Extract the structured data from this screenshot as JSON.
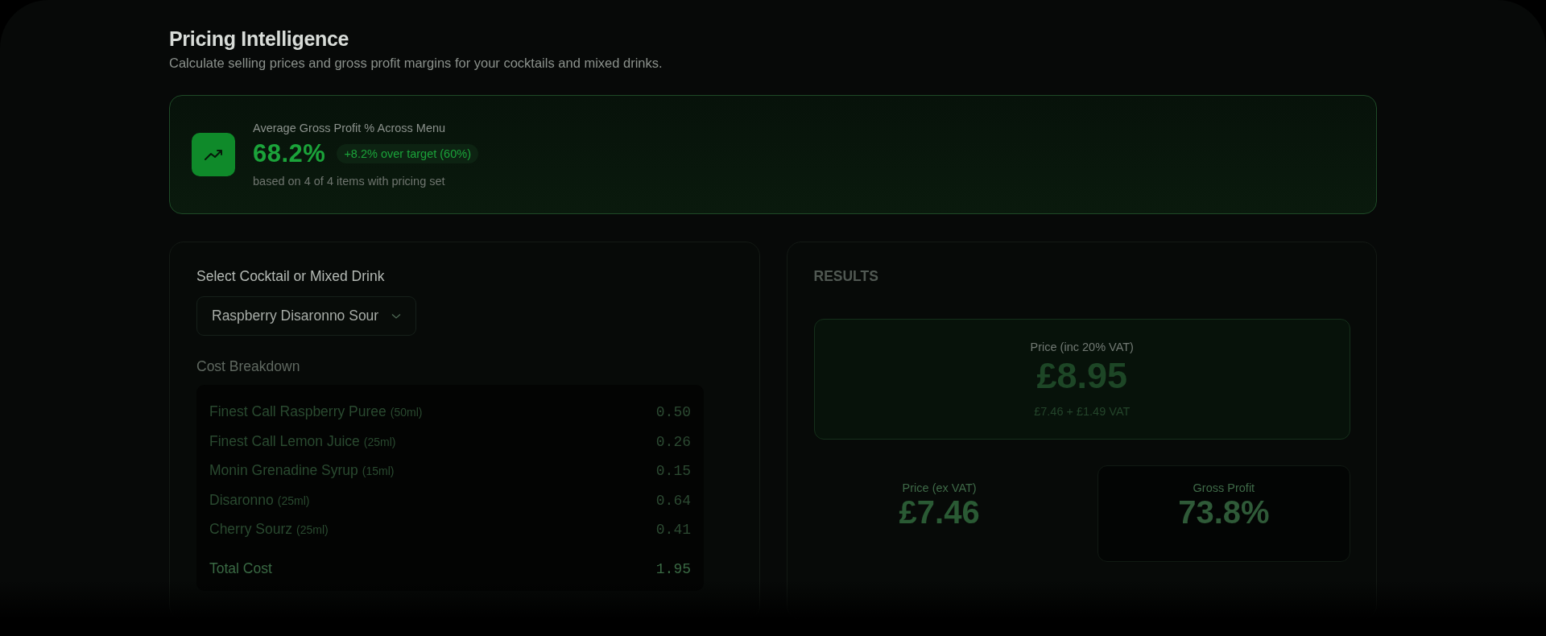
{
  "page": {
    "title": "Pricing Intelligence",
    "subtitle": "Calculate selling prices and gross profit margins for your cocktails and mixed drinks."
  },
  "summary": {
    "label": "Average Gross Profit % Across Menu",
    "value": "68.2%",
    "badge": "+8.2% over target (60%)",
    "note": "based on 4 of 4 items with pricing set"
  },
  "selector": {
    "label": "Select Cocktail or Mixed Drink",
    "value": "Raspberry Disaronno Sour"
  },
  "cost_breakdown": {
    "title": "Cost Breakdown",
    "items": [
      {
        "name": "Finest Call Raspberry Puree",
        "amount": "(50ml)",
        "cost": "0.50"
      },
      {
        "name": "Finest Call Lemon Juice",
        "amount": "(25ml)",
        "cost": "0.26"
      },
      {
        "name": "Monin Grenadine Syrup",
        "amount": "(15ml)",
        "cost": "0.15"
      },
      {
        "name": "Disaronno",
        "amount": "(25ml)",
        "cost": "0.64"
      },
      {
        "name": "Cherry Sourz",
        "amount": "(25ml)",
        "cost": "0.41"
      }
    ],
    "total_label": "Total Cost",
    "total": "1.95"
  },
  "results": {
    "title": "RESULTS",
    "main": {
      "label": "Price (inc 20% VAT)",
      "value": "£8.95",
      "detail": "£7.46 + £1.49 VAT"
    },
    "metrics": [
      {
        "label": "Price (ex VAT)",
        "value": "£7.46",
        "highlighted": false
      },
      {
        "label": "Gross Profit",
        "value": "73.8%",
        "highlighted": true
      }
    ]
  }
}
